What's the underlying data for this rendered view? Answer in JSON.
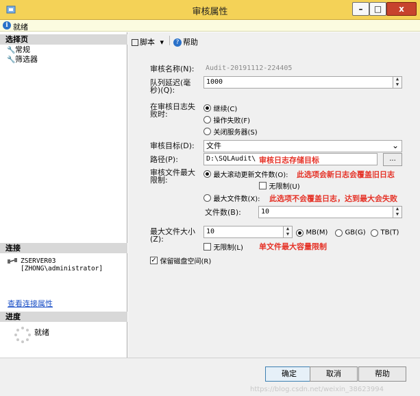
{
  "window": {
    "title": "审核属性",
    "min": "–",
    "max": "□",
    "close": "x"
  },
  "status": {
    "icon": "i",
    "text": "就绪"
  },
  "left": {
    "select_page_header": "选择页",
    "pages": [
      {
        "label": "常规",
        "icon": "wrench-icon"
      },
      {
        "label": "筛选器",
        "icon": "wrench-icon"
      }
    ],
    "connection_header": "连接",
    "connection_server": "ZSERVER03",
    "connection_user": "[ZHONG\\administrator]",
    "view_connection_link": "查看连接属性",
    "progress_header": "进度",
    "progress_text": "就绪"
  },
  "toolbar": {
    "script_label": "脚本",
    "dropdown_arrow": "▾",
    "help_label": "帮助"
  },
  "form": {
    "audit_name_label": "审核名称(N):",
    "audit_name_value": "Audit-20191112-224405",
    "queue_delay_label_1": "队列延迟(毫",
    "queue_delay_label_2": "秒)(Q):",
    "queue_delay_value": "1000",
    "on_failure_label_1": "在审核日志失",
    "on_failure_label_2": "败时:",
    "on_failure_options": [
      "继续(C)",
      "操作失败(F)",
      "关闭服务器(S)"
    ],
    "on_failure_selected": 0,
    "target_label": "审核目标(D):",
    "target_value": "文件",
    "path_label": "路径(P):",
    "path_value": "D:\\SQLAudit\\",
    "path_annotation": "审核日志存储目标",
    "browse_label": "...",
    "max_files_label_1": "审核文件最大",
    "max_files_label_2": "限制:",
    "rollover_label": "最大滚动更新文件数(O):",
    "rollover_annotation": "此选项会新日志会覆盖旧日志",
    "unlimited_label": "无限制(U)",
    "max_files_option_label": "最大文件数(X):",
    "max_files_annotation": "此选项不会覆盖日志，达到最大会失败",
    "file_count_label": "文件数(B):",
    "file_count_value": "10",
    "max_file_size_label_1": "最大文件大小",
    "max_file_size_label_2": "(Z):",
    "max_file_size_value": "10",
    "size_units": [
      "MB(M)",
      "GB(G)",
      "TB(T)"
    ],
    "size_unit_selected": 0,
    "size_unlimited_label": "无限制(L)",
    "size_annotation": "单文件最大容量限制",
    "reserve_disk_label": "保留磁盘空间(R)",
    "spin_up": "▲",
    "spin_down": "▼",
    "dropdown_arrow": "⌄"
  },
  "footer": {
    "ok_label": "确定",
    "cancel_label": "取消",
    "help_label": "帮助",
    "watermark": "https://blog.csdn.net/weixin_38623994"
  },
  "colors": {
    "titlebar": "#f4d257",
    "annotation": "#e53227",
    "link": "#1a4fc6"
  }
}
